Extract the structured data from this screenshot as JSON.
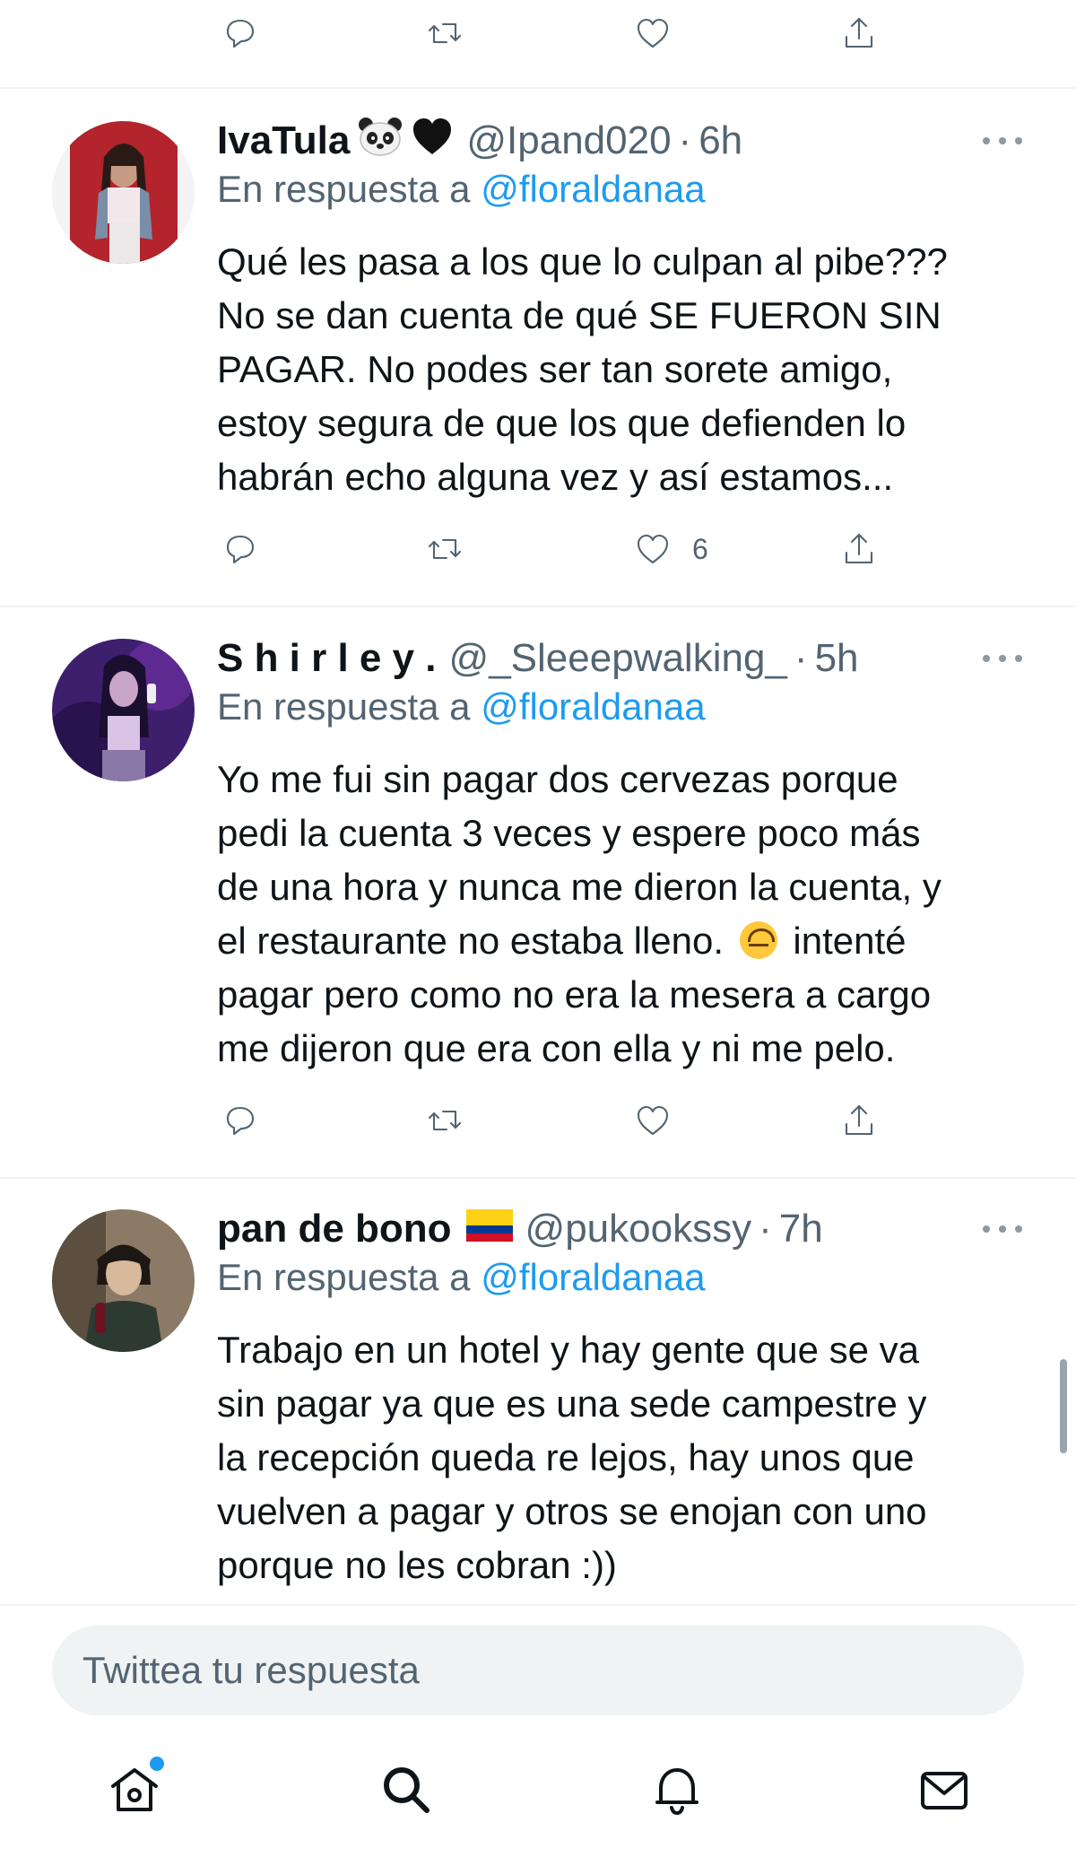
{
  "tweets": [
    {
      "name": "IvaTula",
      "name_emoji": "🐼🖤",
      "handle": "@Ipand020",
      "separator": "·",
      "time": "6h",
      "reply_prefix": "En respuesta a ",
      "reply_to": "@floraldanaa",
      "lines": [
        "Qué les pasa a los que lo culpan al pibe???",
        "No se dan cuenta de qué SE FUERON SIN",
        "PAGAR. No podes ser tan sorete amigo,",
        "estoy segura de que los que defienden lo",
        "habrán echo alguna vez y así estamos..."
      ],
      "like_count": "6"
    },
    {
      "name": "S h i r l e y .",
      "handle": "@_Sleeepwalking_",
      "separator": "·",
      "time": "5h",
      "reply_prefix": "En respuesta a ",
      "reply_to": "@floraldanaa",
      "lines": [
        "Yo me fui sin pagar dos cervezas porque",
        "pedi la cuenta 3 veces y espere poco más",
        "de una hora y nunca me dieron la cuenta, y",
        "el restaurante no estaba lleno.",
        "intenté",
        "pagar pero como no era la mesera a cargo",
        "me dijeron que era con ella y ni me pelo."
      ],
      "inline_emoji": "upside-down-face-icon"
    },
    {
      "name": "pan de bono",
      "name_emoji": "flag-colombia-icon",
      "handle": "@pukookssy",
      "separator": "·",
      "time": "7h",
      "reply_prefix": "En respuesta a ",
      "reply_to": "@floraldanaa",
      "lines": [
        "Trabajo en un hotel y hay gente que se va",
        "sin pagar ya que es una sede campestre y",
        "la recepción queda re lejos, hay unos que",
        "vuelven a pagar y otros se enojan con uno",
        "porque no les cobran :))"
      ]
    }
  ],
  "compose": {
    "placeholder": "Twittea tu respuesta"
  },
  "nav": {
    "items": [
      "home-icon",
      "search-icon",
      "notifications-icon",
      "messages-icon"
    ],
    "home_has_new": true
  },
  "colors": {
    "accent": "#1d9bf0",
    "secondary_text": "#536471",
    "divider": "#eff3f4"
  }
}
